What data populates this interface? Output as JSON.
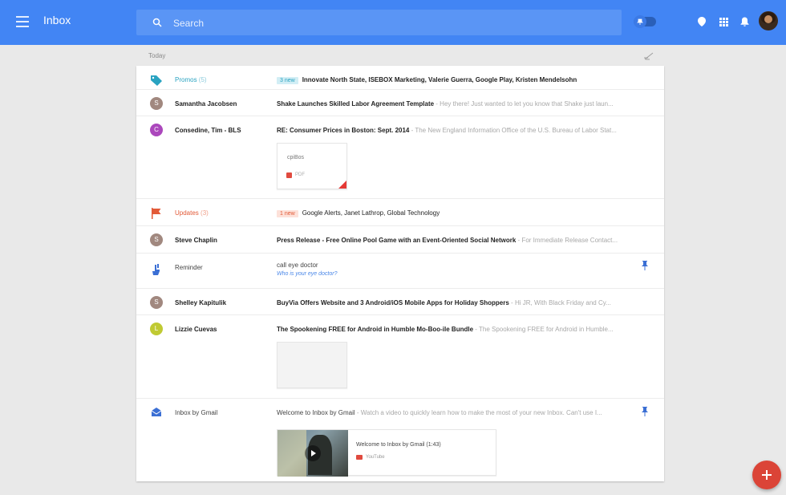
{
  "app": {
    "title": "Inbox"
  },
  "search": {
    "placeholder": "Search"
  },
  "section": {
    "label": "Today"
  },
  "colors": {
    "brand": "#4285f4",
    "promos": "#2aa3c1",
    "updates": "#e25a38",
    "fab": "#db4437"
  },
  "icons": {
    "menu": "menu-icon",
    "search": "search-icon",
    "toggle": "pin-toggle-icon",
    "location": "location-icon",
    "apps": "apps-icon",
    "notifications": "bell-icon",
    "sweep": "sweep-icon",
    "compose": "plus-icon"
  },
  "rows": {
    "promos": {
      "name": "Promos",
      "count": "(5)",
      "badge": "3 new",
      "senders": "Innovate North State, ISEBOX Marketing, Valerie Guerra, Google Play, Kristen Mendelsohn",
      "color": "#2aa3c1"
    },
    "samantha": {
      "initial": "S",
      "sender": "Samantha Jacobsen",
      "subject": "Shake Launches Skilled Labor Agreement Template",
      "snippet": " - Hey there! Just wanted to let you know that Shake just laun...",
      "avatar_color": "#a1887f"
    },
    "consedine": {
      "initial": "C",
      "sender": "Consedine, Tim - BLS",
      "subject": "RE: Consumer Prices in Boston: Sept. 2014",
      "snippet": " - The New England Information Office of the U.S. Bureau of Labor Stat...",
      "avatar_color": "#ab47bc",
      "attachment_name": "cpiBos",
      "attachment_type": "PDF"
    },
    "updates": {
      "name": "Updates",
      "count": "(3)",
      "badge": "1 new",
      "senders": "Google Alerts, Janet Lathrop, Global Technology",
      "color": "#e25a38"
    },
    "steve": {
      "initial": "S",
      "sender": "Steve Chaplin",
      "subject": "Press Release - Free Online Pool Game with an Event-Oriented Social Network",
      "snippet": " - For Immediate Release Contact...",
      "avatar_color": "#a1887f"
    },
    "reminder": {
      "sender": "Reminder",
      "title": "call eye doctor",
      "link": "Who is your eye doctor?"
    },
    "shelley": {
      "initial": "S",
      "sender": "Shelley Kapitulik",
      "subject": "BuyVia Offers Website and 3 Android/iOS Mobile Apps for Holiday Shoppers",
      "snippet": " - Hi JR, With Black Friday and Cy...",
      "avatar_color": "#a1887f"
    },
    "lizzie": {
      "initial": "L",
      "sender": "Lizzie Cuevas",
      "subject": "The Spookening FREE for Android in Humble Mo-Boo-ile Bundle",
      "snippet": " - The Spookening FREE for Android in Humble...",
      "avatar_color": "#c0ca33"
    },
    "inboxgmail": {
      "sender": "Inbox by Gmail",
      "subject": "Welcome to Inbox by Gmail",
      "snippet": " - Watch a video to quickly learn how to make the most of your new Inbox. Can't use I...",
      "video_title": "Welcome to Inbox by Gmail (1:43)",
      "video_source": "YouTube"
    }
  }
}
